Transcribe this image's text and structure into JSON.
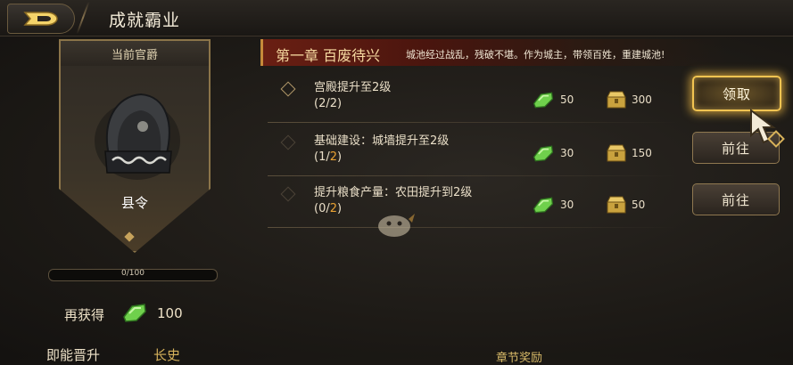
{
  "header": {
    "title": "成就霸业"
  },
  "rank": {
    "heading": "当前官爵",
    "name": "县令",
    "progress_text": "0/100",
    "progress_fraction": 0.0
  },
  "reward": {
    "label": "再获得",
    "value": "100",
    "icon": "jade-icon"
  },
  "partial": {
    "label": "即能晋升",
    "value": "长史"
  },
  "bottom_partial": "章节奖励",
  "chapter": {
    "title": "第一章  百废待兴",
    "desc": "城池经过战乱，残破不堪。作为城主，带领百姓，重建城池!"
  },
  "quests": [
    {
      "title": "宫殿提升至2级",
      "cur": "2",
      "need": "2",
      "jade": "50",
      "gold": "300",
      "button": "领取",
      "claimable": true
    },
    {
      "title": "基础建设：城墙提升至2级",
      "cur": "1",
      "need": "2",
      "jade": "30",
      "gold": "150",
      "button": "前往",
      "claimable": false
    },
    {
      "title": "提升粮食产量：农田提升到2级",
      "cur": "0",
      "need": "2",
      "jade": "30",
      "gold": "50",
      "button": "前往",
      "claimable": false
    }
  ],
  "colors": {
    "accent_gold": "#f2c451",
    "need_orange": "#e9a133",
    "banner_red": "#6a1f13"
  }
}
